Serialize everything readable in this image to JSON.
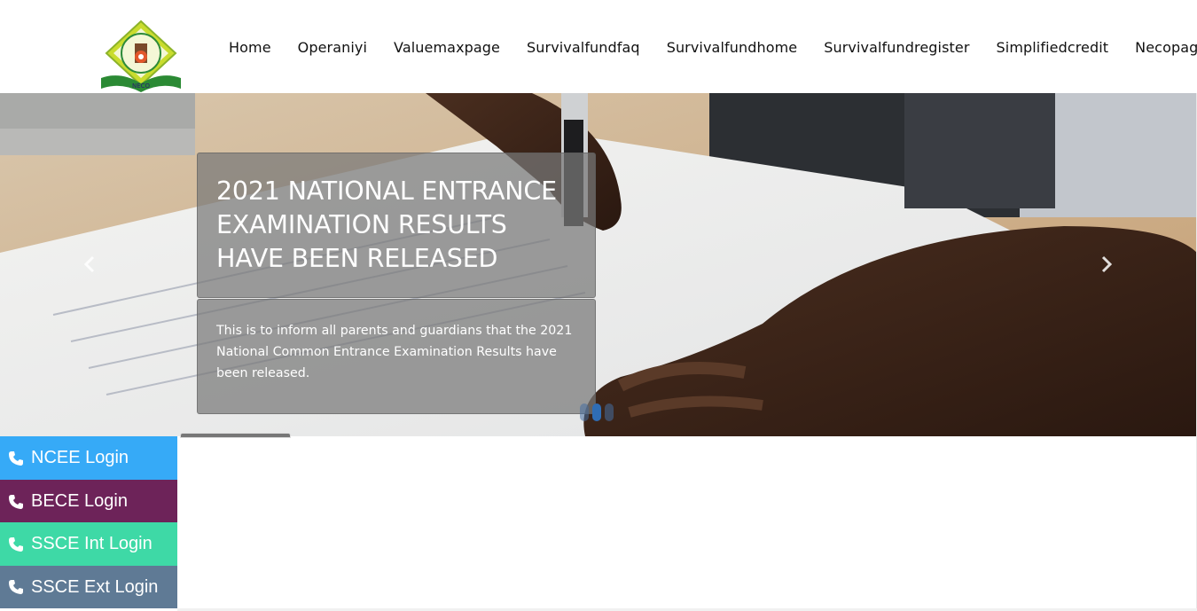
{
  "header": {
    "logo_label": "NECO",
    "nav": [
      "Home",
      "Operaniyi",
      "Valuemaxpage",
      "Survivalfundfaq",
      "Survivalfundhome",
      "Survivalfundregister",
      "Simplifiedcredit",
      "Necopage"
    ]
  },
  "hero": {
    "title": "2021 NATIONAL ENTRANCE EXAMINATION RESULTS HAVE BEEN RELEASED",
    "body": "This is to inform all parents and guardians that the 2021 National Common Entrance Examination Results have been released.",
    "prev_icon": "chevron-left-icon",
    "next_icon": "chevron-right-icon",
    "slides": 3,
    "active_slide": 2
  },
  "logins": [
    {
      "label": "NCEE Login",
      "icon": "phone-icon",
      "color": "#36aaf7"
    },
    {
      "label": "BECE Login",
      "icon": "phone-icon",
      "color": "#6d2359"
    },
    {
      "label": "SSCE Int Login",
      "icon": "phone-icon",
      "color": "#3ed9a6"
    },
    {
      "label": "SSCE Ext Login",
      "icon": "phone-icon",
      "color": "#5f7a95"
    }
  ]
}
